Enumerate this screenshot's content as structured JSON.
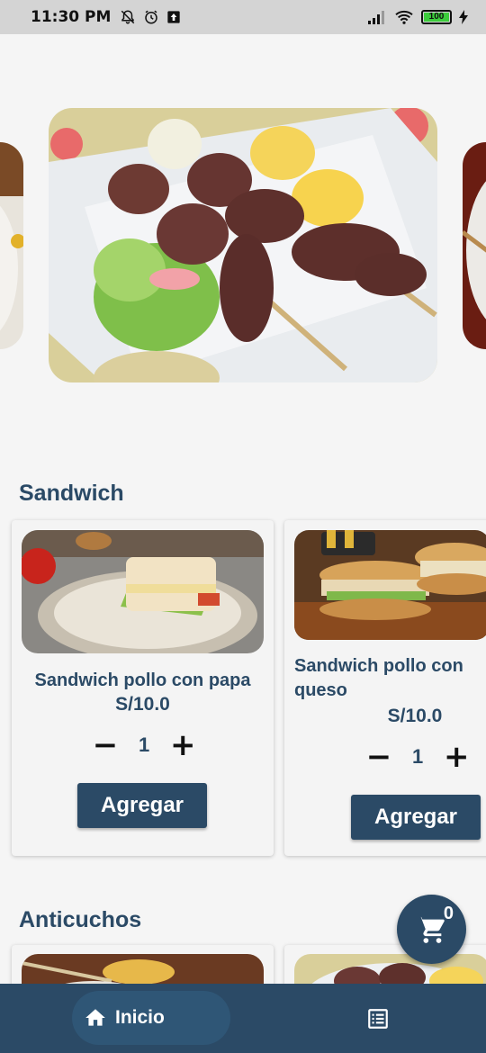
{
  "status_bar": {
    "time": "11:30 PM",
    "battery": "100"
  },
  "sections": [
    {
      "title": "Sandwich",
      "items": [
        {
          "name": "Sandwich pollo con papa",
          "price": "S/10.0",
          "qty": "1",
          "button": "Agregar"
        },
        {
          "name": "Sandwich pollo con queso",
          "price": "S/10.0",
          "qty": "1",
          "button": "Agregar"
        }
      ]
    },
    {
      "title": "Anticuchos",
      "items": []
    }
  ],
  "cart": {
    "count": "0"
  },
  "nav": {
    "home_label": "Inicio"
  },
  "colors": {
    "primary": "#2b4a66",
    "background": "#f5f5f5",
    "statusbar": "#d4d4d4"
  }
}
